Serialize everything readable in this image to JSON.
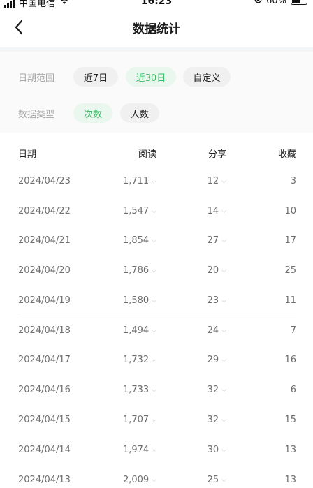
{
  "status_bar": {
    "carrier": "中国电信",
    "time": "16:23",
    "battery": "60%"
  },
  "nav": {
    "title": "数据统计"
  },
  "filters": {
    "date_range": {
      "label": "日期范围",
      "options": [
        "近7日",
        "近30日",
        "自定义"
      ],
      "selected": "近30日"
    },
    "data_type": {
      "label": "数据类型",
      "options": [
        "次数",
        "人数"
      ],
      "selected": "次数"
    }
  },
  "table": {
    "headers": {
      "date": "日期",
      "read": "阅读",
      "share": "分享",
      "fav": "收藏"
    },
    "rows": [
      {
        "date": "2024/04/23",
        "read": "1,711",
        "share": "12",
        "fav": "3"
      },
      {
        "date": "2024/04/22",
        "read": "1,547",
        "share": "14",
        "fav": "10"
      },
      {
        "date": "2024/04/21",
        "read": "1,854",
        "share": "27",
        "fav": "17"
      },
      {
        "date": "2024/04/20",
        "read": "1,786",
        "share": "20",
        "fav": "25"
      },
      {
        "date": "2024/04/19",
        "read": "1,580",
        "share": "23",
        "fav": "11"
      },
      {
        "date": "2024/04/18",
        "read": "1,494",
        "share": "24",
        "fav": "7"
      },
      {
        "date": "2024/04/17",
        "read": "1,732",
        "share": "29",
        "fav": "16"
      },
      {
        "date": "2024/04/16",
        "read": "1,733",
        "share": "32",
        "fav": "6"
      },
      {
        "date": "2024/04/15",
        "read": "1,707",
        "share": "32",
        "fav": "15"
      },
      {
        "date": "2024/04/14",
        "read": "1,974",
        "share": "30",
        "fav": "13"
      },
      {
        "date": "2024/04/13",
        "read": "2,009",
        "share": "25",
        "fav": "13"
      }
    ]
  },
  "colors": {
    "accent": "#3dbb66",
    "accent_bg": "#eaf7ee",
    "chip_bg": "#f0f0f0",
    "panel_bg": "#fafafa"
  },
  "icons": {
    "back": "chevron-left-icon",
    "expand": "chevron-down-icon",
    "wifi": "wifi-icon",
    "signal": "signal-icon",
    "battery": "battery-icon"
  }
}
